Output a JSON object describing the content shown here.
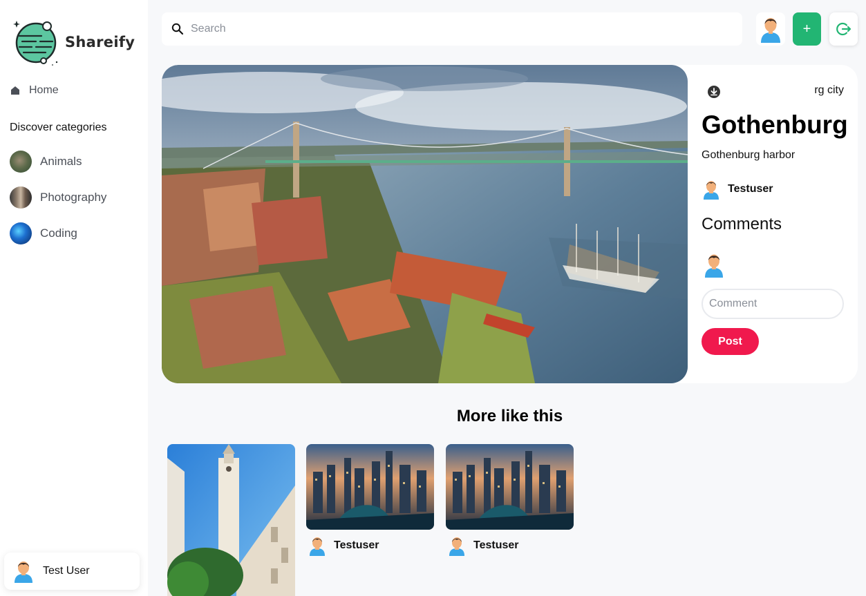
{
  "app": {
    "name": "Shareify"
  },
  "sidebar": {
    "home_label": "Home",
    "discover_label": "Discover categories",
    "categories": [
      {
        "label": "Animals"
      },
      {
        "label": "Photography"
      },
      {
        "label": "Coding"
      }
    ],
    "user_name": "Test User"
  },
  "header": {
    "search_placeholder": "Search",
    "add_label": "+"
  },
  "pin": {
    "destination": "rg city",
    "title": "Gothenburg",
    "about": "Gothenburg harbor",
    "posted_by": "Testuser",
    "comments_heading": "Comments",
    "comment_placeholder": "Comment",
    "post_label": "Post"
  },
  "more": {
    "heading": "More like this",
    "items": [
      {
        "user": ""
      },
      {
        "user": "Testuser"
      },
      {
        "user": "Testuser"
      }
    ]
  },
  "colors": {
    "brand_green": "#22b573",
    "post_red": "#f0194d",
    "logo_teal": "#5cc6a0"
  },
  "icons": {
    "search": "search-icon",
    "home": "home-icon",
    "download": "download-icon",
    "logout": "logout-icon",
    "add": "plus-icon"
  }
}
